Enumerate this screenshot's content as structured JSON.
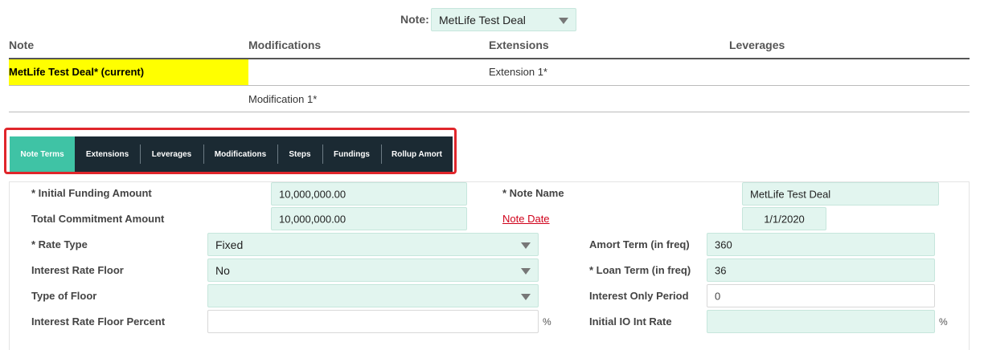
{
  "note_selector": {
    "label": "Note:",
    "value": "MetLife Test Deal"
  },
  "table": {
    "headers": [
      "Note",
      "Modifications",
      "Extensions",
      "Leverages"
    ],
    "current_note": "MetLife Test Deal* (current)",
    "extension": "Extension 1*",
    "modification": "Modification 1*"
  },
  "tabs": [
    {
      "label": "Note Terms",
      "active": true
    },
    {
      "label": "Extensions"
    },
    {
      "label": "Leverages"
    },
    {
      "label": "Modifications"
    },
    {
      "label": "Steps"
    },
    {
      "label": "Fundings"
    },
    {
      "label": "Rollup Amort"
    }
  ],
  "form": {
    "initial_funding_label": "* Initial Funding Amount",
    "initial_funding_value": "10,000,000.00",
    "total_commitment_label": "Total Commitment Amount",
    "total_commitment_value": "10,000,000.00",
    "note_name_label": "* Note Name",
    "note_name_value": "MetLife Test Deal",
    "note_date_label": "Note Date",
    "note_date_value": "1/1/2020",
    "rate_type_label": "* Rate Type",
    "rate_type_value": "Fixed",
    "interest_floor_label": "Interest Rate Floor",
    "interest_floor_value": "No",
    "type_of_floor_label": "Type of Floor",
    "type_of_floor_value": "",
    "floor_percent_label": "Interest Rate Floor Percent",
    "floor_percent_value": "",
    "percent_symbol": "%",
    "amort_term_label": "Amort Term (in freq)",
    "amort_term_value": "360",
    "loan_term_label": "* Loan Term (in freq)",
    "loan_term_value": "36",
    "io_period_label": "Interest Only Period",
    "io_period_value": "0",
    "io_rate_label": "Initial IO Int Rate",
    "io_rate_value": ""
  },
  "colors": {
    "accent": "#3fc3a5",
    "tabbar": "#1b2a33",
    "current_highlight": "#ffff00",
    "callout": "#e0262b",
    "field_bg": "#e2f5ef"
  }
}
